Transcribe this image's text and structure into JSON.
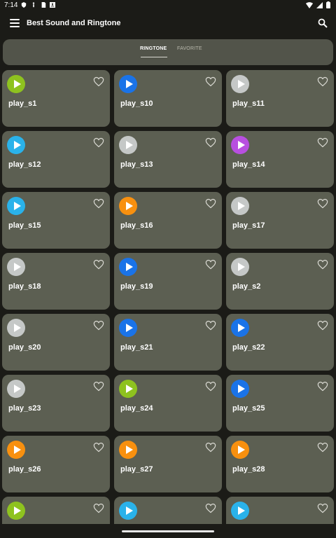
{
  "status_bar": {
    "time": "7:14"
  },
  "app_bar": {
    "title": "Best Sound and Ringtone"
  },
  "tabs": [
    {
      "label": "RINGTONE",
      "selected": true
    },
    {
      "label": "FAVORITE",
      "selected": false
    }
  ],
  "colors": {
    "lime": "#8ec21f",
    "blue": "#1a73e8",
    "gray": "#c5c8c7",
    "sky": "#2ab2ea",
    "purple": "#b84fe0",
    "orange": "#f8900f"
  },
  "sounds": [
    {
      "label": "play_s1",
      "color": "lime"
    },
    {
      "label": "play_s10",
      "color": "blue"
    },
    {
      "label": "play_s11",
      "color": "gray"
    },
    {
      "label": "play_s12",
      "color": "sky"
    },
    {
      "label": "play_s13",
      "color": "gray"
    },
    {
      "label": "play_s14",
      "color": "purple"
    },
    {
      "label": "play_s15",
      "color": "sky"
    },
    {
      "label": "play_s16",
      "color": "orange"
    },
    {
      "label": "play_s17",
      "color": "gray"
    },
    {
      "label": "play_s18",
      "color": "gray"
    },
    {
      "label": "play_s19",
      "color": "blue"
    },
    {
      "label": "play_s2",
      "color": "gray"
    },
    {
      "label": "play_s20",
      "color": "gray"
    },
    {
      "label": "play_s21",
      "color": "blue"
    },
    {
      "label": "play_s22",
      "color": "blue"
    },
    {
      "label": "play_s23",
      "color": "gray"
    },
    {
      "label": "play_s24",
      "color": "lime"
    },
    {
      "label": "play_s25",
      "color": "blue"
    },
    {
      "label": "play_s26",
      "color": "orange"
    },
    {
      "label": "play_s27",
      "color": "orange"
    },
    {
      "label": "play_s28",
      "color": "orange"
    },
    {
      "label": "",
      "color": "lime"
    },
    {
      "label": "",
      "color": "sky"
    },
    {
      "label": "",
      "color": "sky"
    }
  ]
}
